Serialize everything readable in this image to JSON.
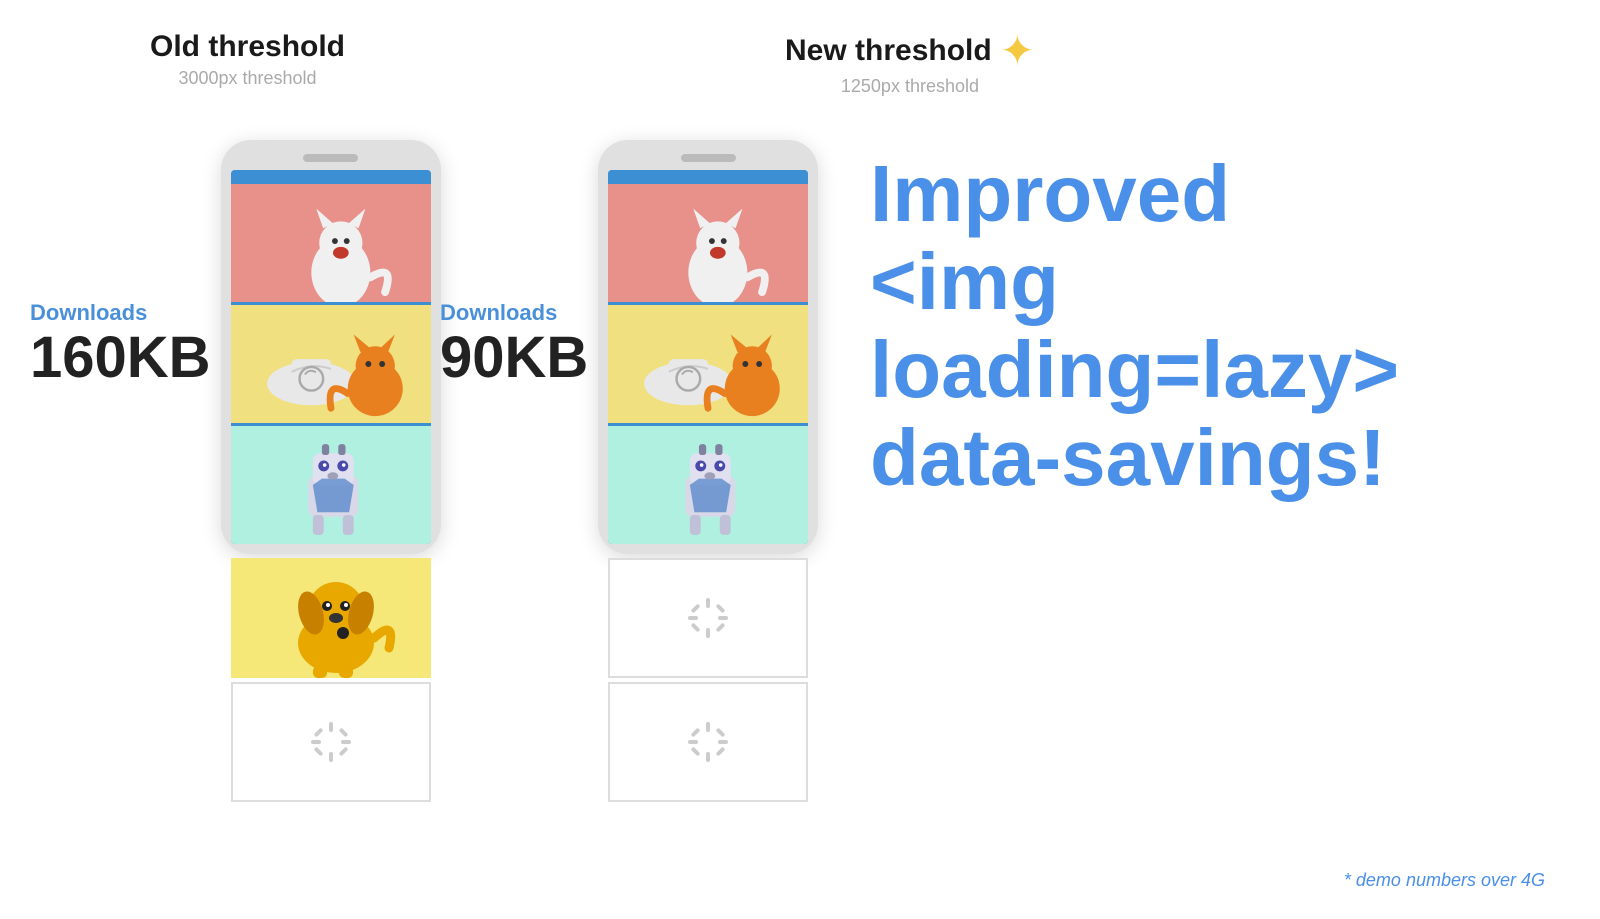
{
  "page": {
    "background": "#ffffff"
  },
  "old_threshold": {
    "title": "Old threshold",
    "subtitle": "3000px threshold",
    "downloads_label": "Downloads",
    "downloads_size": "160KB"
  },
  "new_threshold": {
    "title": "New threshold",
    "subtitle": "1250px threshold",
    "downloads_label": "Downloads",
    "downloads_size": "90KB"
  },
  "headline": {
    "line1": "Improved",
    "line2": "<img loading=lazy>",
    "line3": "data-savings!"
  },
  "footer": {
    "note": "* demo numbers over 4G"
  },
  "sparkle_icon": "✦",
  "loading_spinner": "spinner-icon"
}
